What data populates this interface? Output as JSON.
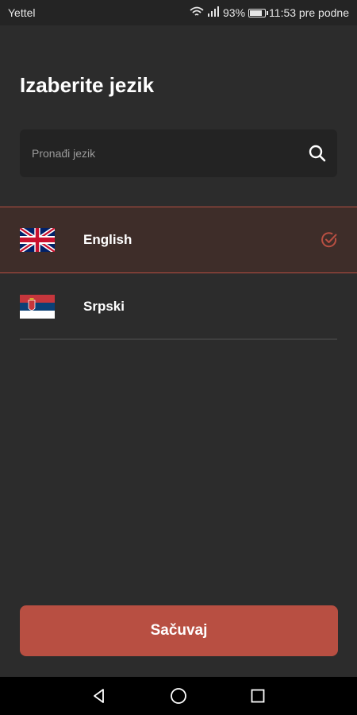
{
  "status_bar": {
    "carrier": "Yettel",
    "battery": "93%",
    "battery_level": 0.93,
    "time": "11:53 pre podne"
  },
  "page": {
    "title": "Izaberite jezik"
  },
  "search": {
    "placeholder": "Pronađi jezik",
    "value": ""
  },
  "languages": [
    {
      "label": "English",
      "flag": "uk-flag-icon",
      "selected": true
    },
    {
      "label": "Srpski",
      "flag": "serbia-flag-icon",
      "selected": false
    }
  ],
  "actions": {
    "save_label": "Sačuvaj"
  },
  "colors": {
    "accent": "#b84f42",
    "background": "#2c2c2c",
    "selected_row": "#3e2d29"
  }
}
